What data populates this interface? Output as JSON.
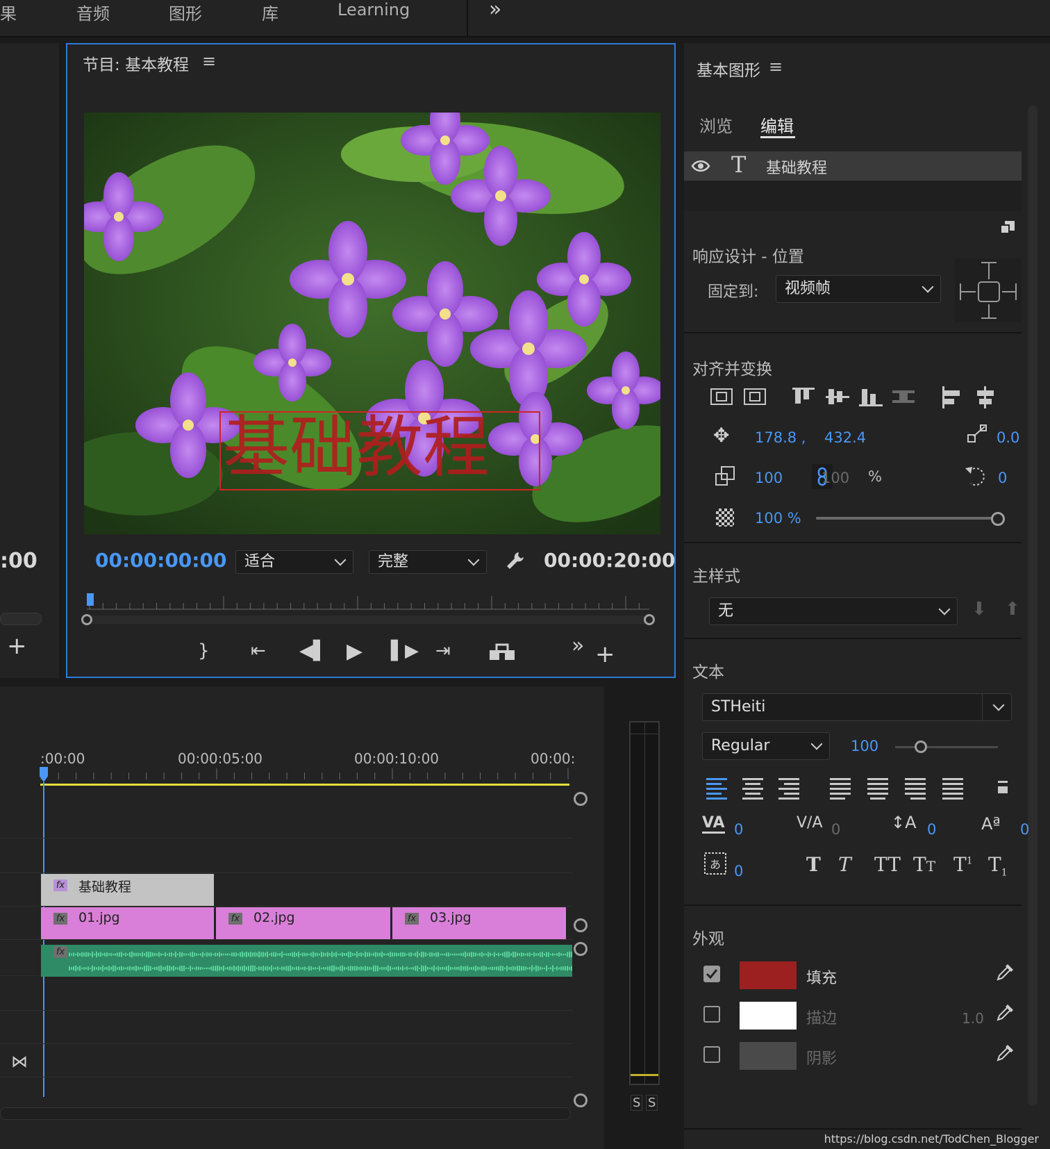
{
  "workspace_tabs": [
    "果",
    "音频",
    "图形",
    "库",
    "Learning"
  ],
  "workspace_more": "»",
  "program_monitor": {
    "title": "节目: 基本教程",
    "menu_icon": "≡",
    "overlay_text": "基础教程",
    "overlay_color": "#b01e1e",
    "current_time": "00:00:00:00",
    "zoom_select": "适合",
    "quality_select": "完整",
    "duration": "00:00:20:00"
  },
  "left_strip": {
    "time_fragment": ":00",
    "add": "+"
  },
  "essential_graphics": {
    "title": "基本图形",
    "menu_icon": "≡",
    "tabs": [
      "浏览",
      "编辑"
    ],
    "active_tab": "编辑",
    "layer_name": "基础教程",
    "responsive_section": "响应设计 - 位置",
    "pin_label": "固定到:",
    "pin_value": "视频帧",
    "align_section": "对齐并变换",
    "position_x": "178.8 ,",
    "position_y": "432.4",
    "anchor_value": "0.0",
    "scale": "100",
    "scale_linked": "100",
    "scale_unit": "%",
    "rotation": "0",
    "opacity": "100 %",
    "opacity_level": 1.0,
    "master_style_section": "主样式",
    "master_style_value": "无",
    "text_section": "文本",
    "font_family": "STHeiti",
    "font_style": "Regular",
    "font_size": "100",
    "font_size_level": 0.25,
    "kerning": "0",
    "tracking": "0",
    "leading": "0",
    "baseline_shift": "0",
    "tsume": "0",
    "appearance_section": "外观",
    "fill_label": "填充",
    "fill_checked": true,
    "fill_color": "#9c2020",
    "stroke_label": "描边",
    "stroke_checked": false,
    "stroke_color": "#ffffff",
    "stroke_width": "1.0",
    "shadow_label": "阴影",
    "shadow_checked": false,
    "shadow_color": "#4a4a4a"
  },
  "timeline": {
    "ruler_labels": [
      ":00:00",
      "00:00:05:00",
      "00:00:10:00",
      "00:00:"
    ],
    "title_clip": "基础教程",
    "video_clips": [
      "01.jpg",
      "02.jpg",
      "03.jpg"
    ],
    "clip_color": "#d97fd9",
    "audio_color": "#2f8a66"
  },
  "meter_labels": [
    "S",
    "S"
  ],
  "watermark": "https://blog.csdn.net/TodChen_Blogger"
}
